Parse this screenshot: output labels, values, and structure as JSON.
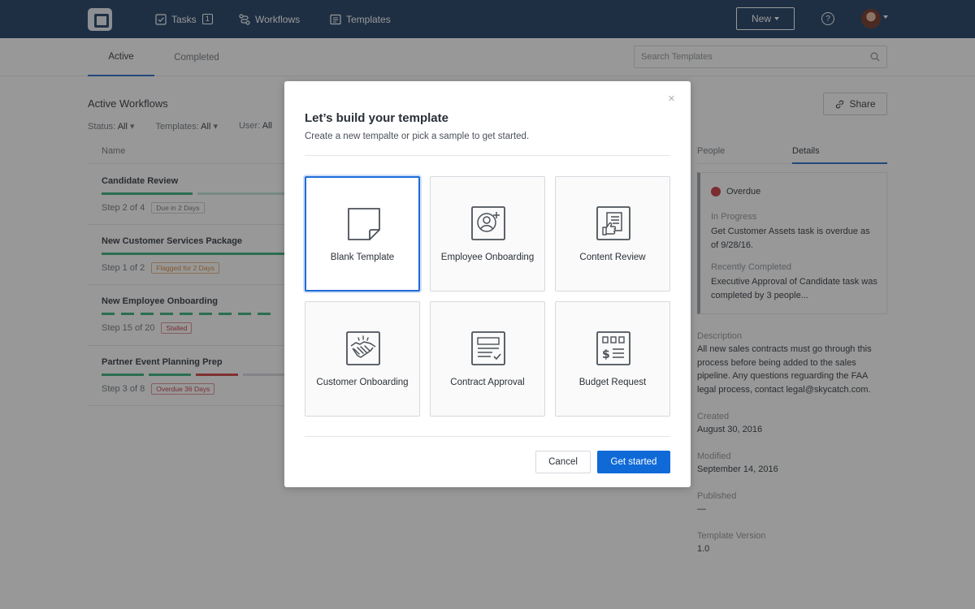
{
  "nav": {
    "tasks_label": "Tasks",
    "tasks_count": "1",
    "workflows_label": "Workflows",
    "templates_label": "Templates",
    "new_label": "New",
    "help_label": "?"
  },
  "subbar": {
    "tabs": [
      "Active",
      "Completed"
    ],
    "search_placeholder": "Search Templates"
  },
  "list": {
    "title": "Active Workflows",
    "filters": [
      {
        "label": "Status:",
        "value": "All"
      },
      {
        "label": "Templates:",
        "value": "All"
      },
      {
        "label": "User:",
        "value": "All"
      }
    ],
    "column_name": "Name",
    "share_label": "Share",
    "rows": [
      {
        "name": "Candidate Review",
        "step": "Step 2 of 4",
        "badge": "Due in 2 Days"
      },
      {
        "name": "New Customer Services Package",
        "step": "Step 1 of 2",
        "badge": "Flagged for 2 Days"
      },
      {
        "name": "New Employee Onboarding",
        "step": "Step 15 of 20",
        "badge": "Stalled"
      },
      {
        "name": "Partner Event Planning Prep",
        "step": "Step 3 of 8",
        "badge": "Overdue 36 Days"
      }
    ]
  },
  "sidepanel": {
    "tabs": [
      "People",
      "Details"
    ],
    "overdue_label": "Overdue",
    "in_progress_label": "In Progress",
    "in_progress_text": "Get Customer Assets task is overdue as of 9/28/16.",
    "recently_completed_label": "Recently Completed",
    "recently_completed_text": "Executive Approval of Candidate task was completed by 3 people...",
    "description_label": "Description",
    "description_text": "All new sales contracts must go through this process before being added to the sales pipeline. Any questions reguarding the FAA legal process, contact legal@skycatch.com.",
    "created_label": "Created",
    "created_value": "August 30, 2016",
    "modified_label": "Modified",
    "modified_value": "September 14, 2016",
    "published_label": "Published",
    "published_value": "—",
    "version_label": "Template Version",
    "version_value": "1.0"
  },
  "modal": {
    "close_label": "×",
    "title": "Let’s build your template",
    "subtitle": "Create a new tempalte or pick a sample to get started.",
    "cards": [
      {
        "label": "Blank Template",
        "icon": "blank-page-icon",
        "selected": true
      },
      {
        "label": "Employee Onboarding",
        "icon": "add-user-icon",
        "selected": false
      },
      {
        "label": "Content Review",
        "icon": "thumbs-up-document-icon",
        "selected": false
      },
      {
        "label": "Customer Onboarding",
        "icon": "handshake-icon",
        "selected": false
      },
      {
        "label": "Contract Approval",
        "icon": "contract-check-icon",
        "selected": false
      },
      {
        "label": "Budget Request",
        "icon": "budget-calculator-icon",
        "selected": false
      }
    ],
    "cancel_label": "Cancel",
    "start_label": "Get started"
  },
  "colors": {
    "nav_bg": "#16375e",
    "accent": "#0f6ad8",
    "progress_green": "#2fae78",
    "progress_red": "#d23b3b",
    "overdue_red": "#c8323c"
  }
}
